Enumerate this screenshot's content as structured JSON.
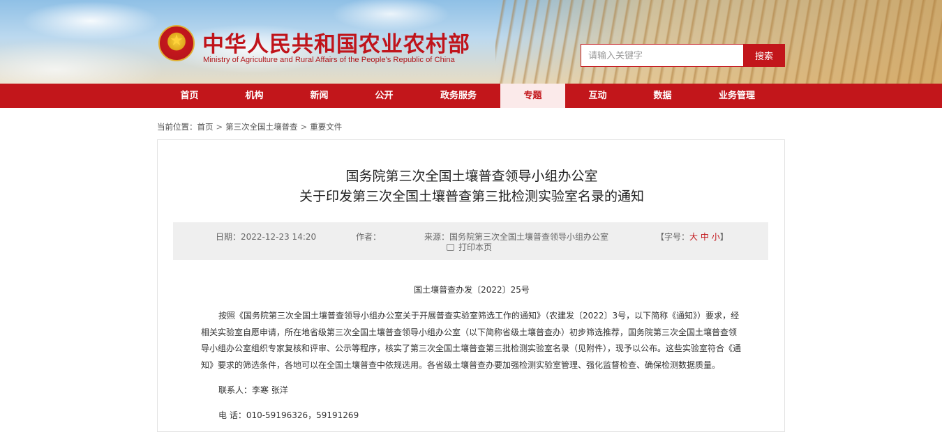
{
  "header": {
    "site_title": "中华人民共和国农业农村部",
    "site_subtitle": "Ministry of Agriculture and Rural Affairs of the People's Republic of China",
    "emblem_icon": "national-emblem-icon"
  },
  "search": {
    "placeholder": "请输入关键字",
    "button_label": "搜索"
  },
  "nav": {
    "items": [
      {
        "label": "首页",
        "active": false
      },
      {
        "label": "机构",
        "active": false
      },
      {
        "label": "新闻",
        "active": false
      },
      {
        "label": "公开",
        "active": false
      },
      {
        "label": "政务服务",
        "active": false
      },
      {
        "label": "专题",
        "active": true
      },
      {
        "label": "互动",
        "active": false
      },
      {
        "label": "数据",
        "active": false
      },
      {
        "label": "业务管理",
        "active": false
      }
    ]
  },
  "breadcrumb": {
    "prefix": "当前位置：",
    "items": [
      "首页",
      "第三次全国土壤普查",
      "重要文件"
    ],
    "separator": ">"
  },
  "article": {
    "title_line1": "国务院第三次全国土壤普查领导小组办公室",
    "title_line2": "关于印发第三次全国土壤普查第三批检测实验室名录的通知",
    "date": "日期：2022-12-23 14:20",
    "author": "作者：",
    "source": "来源：国务院第三次全国土壤普查领导小组办公室",
    "print_label": "打印本页",
    "fontsize_label_open": "【字号：",
    "fontsize_large": "大",
    "fontsize_medium": "中",
    "fontsize_small": "小",
    "fontsize_label_close": "】",
    "doc_number": "国土壤普查办发〔2022〕25号",
    "paragraph": "按照《国务院第三次全国土壤普查领导小组办公室关于开展普查实验室筛选工作的通知》（农建发〔2022〕3号，以下简称《通知》）要求，经相关实验室自愿申请，所在地省级第三次全国土壤普查领导小组办公室（以下简称省级土壤普查办）初步筛选推荐，国务院第三次全国土壤普查领导小组办公室组织专家复核和评审、公示等程序，核实了第三次全国土壤普查第三批检测实验室名录（见附件），现予以公布。这些实验室符合《通知》要求的筛选条件，各地可以在全国土壤普查中依规选用。各省级土壤普查办要加强检测实验室管理、强化监督检查、确保检测数据质量。",
    "contact": "联系人：李寒  张洋",
    "phone": "电  话：010-59196326，59191269"
  },
  "colors": {
    "brand_red": "#c2161b",
    "nav_active_bg": "#fbeaea",
    "meta_bg": "#efefef"
  }
}
